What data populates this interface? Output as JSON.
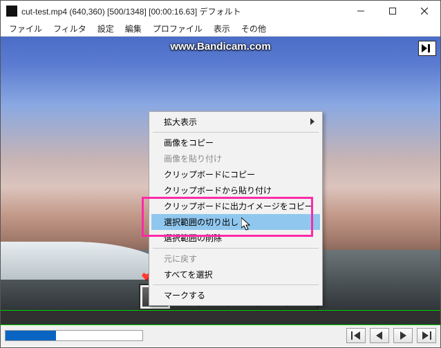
{
  "titlebar": {
    "app_icon": "app-icon",
    "title": "cut-test.mp4 (640,360)  [500/1348]  [00:00:16.63]  デフォルト"
  },
  "window_controls": {
    "minimize": "minimize",
    "maximize": "maximize",
    "close": "close"
  },
  "menubar": {
    "items": [
      "ファイル",
      "フィルタ",
      "設定",
      "編集",
      "プロファイル",
      "表示",
      "その他"
    ]
  },
  "viewport": {
    "watermark": "www.Bandicam.com",
    "jump_end_icon": "jump-to-end"
  },
  "context_menu": {
    "items": [
      {
        "label": "拡大表示",
        "submenu": true,
        "disabled": false
      },
      {
        "sep": true
      },
      {
        "label": "画像をコピー",
        "disabled": false
      },
      {
        "label": "画像を貼り付け",
        "disabled": true
      },
      {
        "label": "クリップボードにコピー",
        "disabled": false
      },
      {
        "label": "クリップボードから貼り付け",
        "disabled": false
      },
      {
        "label": "クリップボードに出力イメージをコピー",
        "disabled": false
      },
      {
        "label": "選択範囲の切り出し",
        "disabled": false,
        "highlighted": true
      },
      {
        "label": "選択範囲の削除",
        "disabled": false
      },
      {
        "sep": true
      },
      {
        "label": "元に戻す",
        "disabled": true
      },
      {
        "label": "すべてを選択",
        "disabled": false
      },
      {
        "sep": true
      },
      {
        "label": "マークする",
        "disabled": false
      }
    ]
  },
  "slider": {
    "percent": 37
  },
  "nav": {
    "prev_key": "prev-keyframe",
    "prev_frame": "prev-frame",
    "next_frame": "next-frame",
    "next_key": "next-keyframe"
  }
}
